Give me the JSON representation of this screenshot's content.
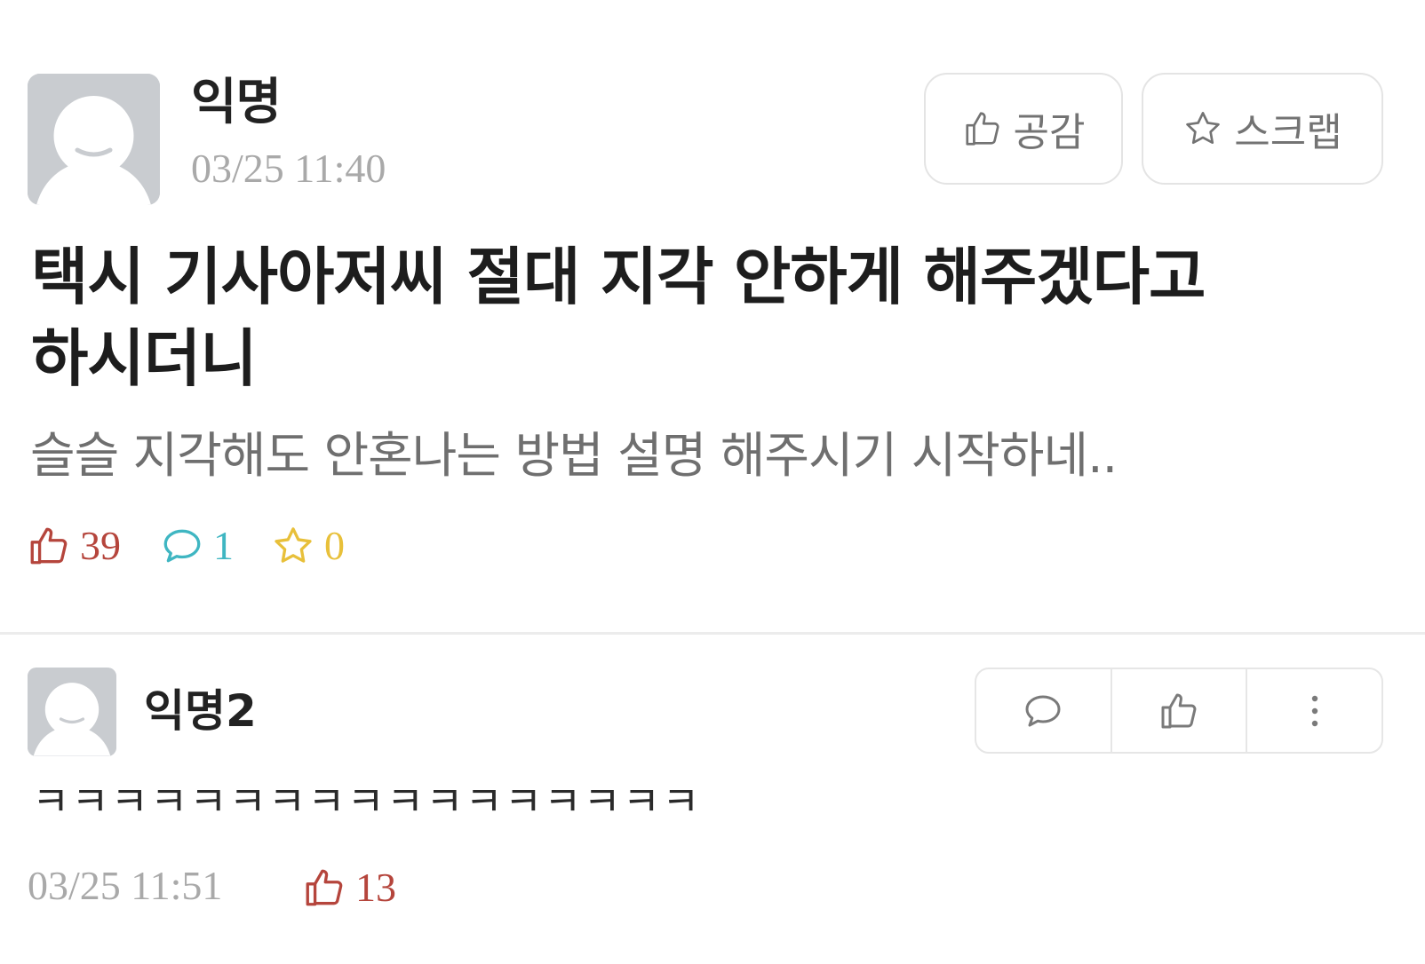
{
  "post": {
    "author": "익명",
    "timestamp": "03/25 11:40",
    "like_button_label": "공감",
    "scrap_button_label": "스크랩",
    "title_line1": "택시 기사아저씨 절대 지각 안하게 해주겠다고",
    "title_line2": "하시더니",
    "body": "슬슬 지각해도 안혼나는 방법 설명 해주시기 시작하네..",
    "stats": {
      "likes": "39",
      "comments": "1",
      "scraps": "0"
    },
    "colors": {
      "likes": "#b5453c",
      "comments": "#3fb6c2",
      "scraps": "#e8c03a"
    }
  },
  "comment": {
    "author": "익명2",
    "text": "ㅋㅋㅋㅋㅋㅋㅋㅋㅋㅋㅋㅋㅋㅋㅋㅋㅋ",
    "timestamp": "03/25 11:51",
    "likes": "13",
    "actions": [
      "reply-icon",
      "thumbs-up-icon",
      "more-vertical-icon"
    ]
  }
}
